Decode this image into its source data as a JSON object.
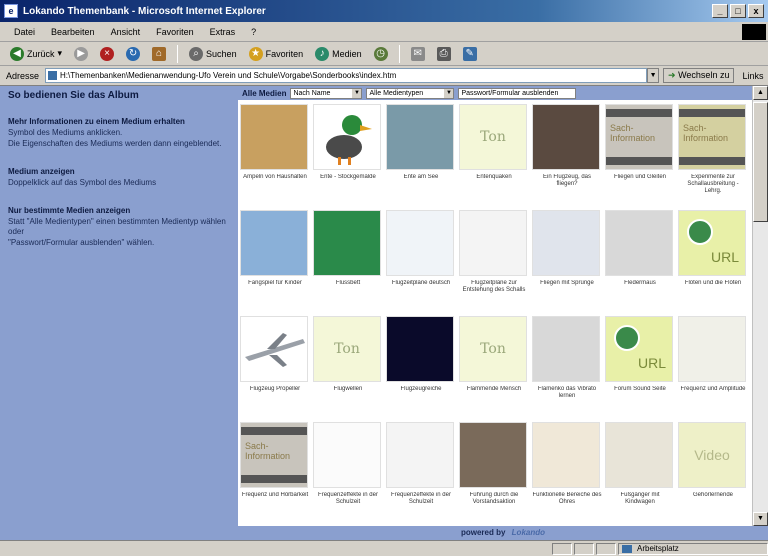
{
  "window": {
    "title": "Lokando Themenbank - Microsoft Internet Explorer",
    "buttons": [
      "_",
      "□",
      "x"
    ]
  },
  "menubar": [
    "Datei",
    "Bearbeiten",
    "Ansicht",
    "Favoriten",
    "Extras",
    "?"
  ],
  "toolbar": {
    "back": "Zurück",
    "search": "Suchen",
    "favorites": "Favoriten",
    "media": "Medien"
  },
  "address": {
    "label": "Adresse",
    "url": "H:\\Themenbanken\\Medienanwendung-Ufo Verein und Schule\\Vorgabe\\Sonderbooks\\index.htm",
    "go": "Wechseln zu",
    "links": "Links"
  },
  "left_panel": {
    "title": "So bedienen Sie das Album",
    "sections": [
      {
        "heading": "Mehr Informationen zu einem Medium erhalten",
        "lines": [
          "Symbol des Mediums anklicken.",
          "Die Eigenschaften des Mediums werden dann eingeblendet."
        ]
      },
      {
        "heading": "Medium anzeigen",
        "lines": [
          "Doppelklick auf das Symbol des Mediums"
        ]
      },
      {
        "heading": "Nur bestimmte Medien anzeigen",
        "lines": [
          "Statt \"Alle Medientypen\" einen bestimmten Medientyp wählen oder",
          "\"Passwort/Formular ausblenden\" wählen."
        ]
      }
    ]
  },
  "filter": {
    "label": "Alle Medien",
    "sort": "Nach Name",
    "type": "Alle Medientypen",
    "extra": "Passwort/Formular ausblenden"
  },
  "tiles": [
    {
      "caption": "Ampeln von Haushalten",
      "kind": "photo",
      "bg": "#c8a060"
    },
    {
      "caption": "Ente - Stockgemälde",
      "kind": "duck",
      "bg": "#ffffff"
    },
    {
      "caption": "Ente am See",
      "kind": "photo",
      "bg": "#7a9aa8"
    },
    {
      "caption": "Entenquaken",
      "kind": "ton",
      "bg": "#f4f7d8"
    },
    {
      "caption": "Ein Flugzeug, das fliegen?",
      "kind": "photo",
      "bg": "#5a4a40"
    },
    {
      "caption": "Fliegen und Gleiten",
      "kind": "info",
      "bg": "#c8c4bc"
    },
    {
      "caption": "Experimente zur Schallausbreitung - Lehrg.",
      "kind": "info",
      "bg": "#d4d0a0"
    },
    {
      "caption": "Fangspiel für Kinder",
      "kind": "photo",
      "bg": "#8ab0d8"
    },
    {
      "caption": "Flussbett",
      "kind": "photo",
      "bg": "#2a8a4a"
    },
    {
      "caption": "Flugzeitpläne deutsch",
      "kind": "photo",
      "bg": "#f0f4f8"
    },
    {
      "caption": "Flugzeitpläne zur Entstehung des Schalls",
      "kind": "photo",
      "bg": "#f4f4f4"
    },
    {
      "caption": "Fliegen mit Sprünge",
      "kind": "photo",
      "bg": "#e0e4ec"
    },
    {
      "caption": "Fledermaus",
      "kind": "photo",
      "bg": "#d8d8d8"
    },
    {
      "caption": "Flöten und die Flöten",
      "kind": "url",
      "bg": "#e8f0a8"
    },
    {
      "caption": "Flugzeug Propeller",
      "kind": "plane",
      "bg": "#ffffff"
    },
    {
      "caption": "Flugwellen",
      "kind": "ton",
      "bg": "#f4f7d8"
    },
    {
      "caption": "Flugzeugreiche",
      "kind": "photo",
      "bg": "#0a0a2a"
    },
    {
      "caption": "Flammende Mensch",
      "kind": "ton",
      "bg": "#f4f7d8"
    },
    {
      "caption": "Flamenko das Vibrato lernen",
      "kind": "photo",
      "bg": "#d8d8d8"
    },
    {
      "caption": "Forum Sound Seite",
      "kind": "url",
      "bg": "#e8f0a8"
    },
    {
      "caption": "Frequenz und Amplitude",
      "kind": "photo",
      "bg": "#f0f0e8"
    },
    {
      "caption": "Frequenz und Hörbarkeit",
      "kind": "info",
      "bg": "#c8c4bc"
    },
    {
      "caption": "Frequenzeffekte in der Schulzeit",
      "kind": "photo",
      "bg": "#fbfbfb"
    },
    {
      "caption": "Frequenzeffekte in der Schulzeit",
      "kind": "photo",
      "bg": "#f4f4f4"
    },
    {
      "caption": "Führung durch die Vorstandsaktion",
      "kind": "photo",
      "bg": "#7a6a5a"
    },
    {
      "caption": "Funktionelle Bereiche des Ohres",
      "kind": "photo",
      "bg": "#f0e8d8"
    },
    {
      "caption": "Fußgänger mit Kindwagen",
      "kind": "photo",
      "bg": "#e8e4d8"
    },
    {
      "caption": "Gehörlernende",
      "kind": "video",
      "bg": "#eef0c8"
    }
  ],
  "tile_text": {
    "ton": "Ton",
    "url": "URL",
    "info": "Sach-Information",
    "video": "Video"
  },
  "footer": {
    "prefix": "powered by",
    "brand": "Lokando"
  },
  "statusbar": {
    "text": "",
    "zone": "Arbeitsplatz"
  },
  "colors": {
    "panel": "#8a9fcf",
    "titlebar": "#0a246a"
  }
}
